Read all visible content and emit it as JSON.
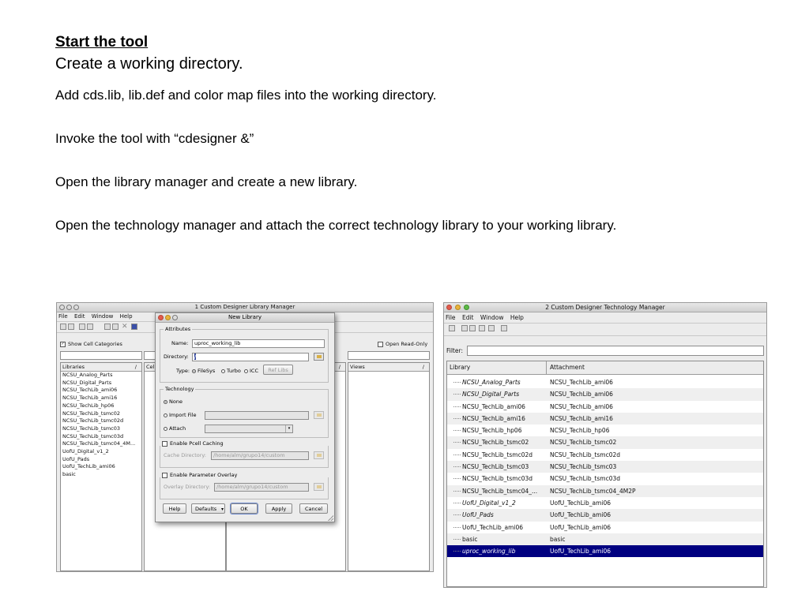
{
  "slide": {
    "title": "Start the tool",
    "subtitle": "Create a working directory.",
    "paragraphs": [
      "Add cds.lib, lib.def and color map files into the working directory.",
      "Invoke the tool with “cdesigner &”",
      "Open the library manager and create a new library.",
      "Open the technology manager and attach the correct technology library to your working library."
    ]
  },
  "lib_manager": {
    "title": "1 Custom Designer Library Manager",
    "menu": [
      "File",
      "Edit",
      "Window",
      "Help"
    ],
    "show_cell_categories": "Show Cell Categories",
    "open_read_only": "Open Read-Only",
    "col_libraries": "Libraries",
    "col_cells": "Cel",
    "col_views": "Views",
    "libraries": [
      "NCSU_Analog_Parts",
      "NCSU_Digital_Parts",
      "NCSU_TechLib_ami06",
      "NCSU_TechLib_ami16",
      "NCSU_TechLib_hp06",
      "NCSU_TechLib_tsmc02",
      "NCSU_TechLib_tsmc02d",
      "NCSU_TechLib_tsmc03",
      "NCSU_TechLib_tsmc03d",
      "NCSU_TechLib_tsmc04_4M...",
      "UofU_Digital_v1_2",
      "UofU_Pads",
      "UofU_TechLib_ami06",
      "basic"
    ]
  },
  "new_library": {
    "title": "New Library",
    "attributes": "Attributes",
    "name_label": "Name:",
    "name_value": "uproc_working_lib",
    "directory_label": "Directory:",
    "directory_value": "/",
    "type_label": "Type:",
    "type_filesys": "FileSys",
    "type_turbo": "Turbo",
    "type_icc": "ICC",
    "ref_libs": "Ref Libs",
    "technology": "Technology",
    "tech_none": "None",
    "tech_import": "Import File",
    "tech_attach": "Attach",
    "pcell_caching": "Enable Pcell Caching",
    "cache_dir_label": "Cache Directory:",
    "cache_dir_value": "/home/alm/grupo14/custom",
    "param_overlay": "Enable Parameter Overlay",
    "overlay_dir_label": "Overlay Directory:",
    "overlay_dir_value": "/home/alm/grupo14/custom",
    "btn_help": "Help",
    "btn_defaults": "Defaults",
    "btn_ok": "OK",
    "btn_apply": "Apply",
    "btn_cancel": "Cancel"
  },
  "tech_manager": {
    "title": "2 Custom Designer Technology Manager",
    "menu": [
      "File",
      "Edit",
      "Window",
      "Help"
    ],
    "filter_label": "Filter:",
    "col_library": "Library",
    "col_attachment": "Attachment",
    "rows": [
      {
        "library": "NCSU_Analog_Parts",
        "attachment": "NCSU_TechLib_ami06",
        "italic": true
      },
      {
        "library": "NCSU_Digital_Parts",
        "attachment": "NCSU_TechLib_ami06",
        "italic": true
      },
      {
        "library": "NCSU_TechLib_ami06",
        "attachment": "NCSU_TechLib_ami06",
        "italic": false
      },
      {
        "library": "NCSU_TechLib_ami16",
        "attachment": "NCSU_TechLib_ami16",
        "italic": false
      },
      {
        "library": "NCSU_TechLib_hp06",
        "attachment": "NCSU_TechLib_hp06",
        "italic": false
      },
      {
        "library": "NCSU_TechLib_tsmc02",
        "attachment": "NCSU_TechLib_tsmc02",
        "italic": false
      },
      {
        "library": "NCSU_TechLib_tsmc02d",
        "attachment": "NCSU_TechLib_tsmc02d",
        "italic": false
      },
      {
        "library": "NCSU_TechLib_tsmc03",
        "attachment": "NCSU_TechLib_tsmc03",
        "italic": false
      },
      {
        "library": "NCSU_TechLib_tsmc03d",
        "attachment": "NCSU_TechLib_tsmc03d",
        "italic": false
      },
      {
        "library": "NCSU_TechLib_tsmc04_...",
        "attachment": "NCSU_TechLib_tsmc04_4M2P",
        "italic": false
      },
      {
        "library": "UofU_Digital_v1_2",
        "attachment": "UofU_TechLib_ami06",
        "italic": true
      },
      {
        "library": "UofU_Pads",
        "attachment": "UofU_TechLib_ami06",
        "italic": true
      },
      {
        "library": "UofU_TechLib_ami06",
        "attachment": "UofU_TechLib_ami06",
        "italic": false
      },
      {
        "library": "basic",
        "attachment": "basic",
        "italic": false
      },
      {
        "library": "uproc_working_lib",
        "attachment": "UofU_TechLib_ami06",
        "italic": true,
        "selected": true
      }
    ]
  },
  "colors": {
    "selection": "#000080",
    "traffic_close": "#e25b4d",
    "traffic_min": "#e8b33a",
    "traffic_max": "#5dbb46"
  }
}
